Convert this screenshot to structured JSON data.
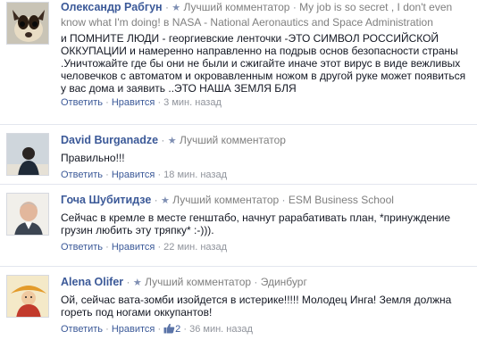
{
  "comments": [
    {
      "author": "Олександр Рабгун",
      "badge": "Лучший комментатор",
      "meta": "My job is so secret , I don't even know what I'm doing! в NASA - National Aeronautics and Space Administration",
      "text": "и ПОМНИТЕ ЛЮДИ - георгиевские ленточки -ЭТО СИМВОЛ РОССИЙСКОЙ ОККУПАЦИИ и намеренно направленно на подрыв основ безопасности страны .Уничтожайте где бы они не были и сжигайте иначе этот вирус в виде вежливых человечков с автоматом и окровавленным ножом в другой руке может появиться у вас дома и заявить ..ЭТО НАША ЗЕМЛЯ БЛЯ",
      "reply": "Ответить",
      "like": "Нравится",
      "time": "3 мин. назад"
    },
    {
      "author": "David Burganadze",
      "badge": "Лучший комментатор",
      "text": "Правильно!!!",
      "reply": "Ответить",
      "like": "Нравится",
      "time": "18 мин. назад"
    },
    {
      "author": "Гоча Шубитидзе",
      "badge": "Лучший комментатор",
      "meta": "ESM Business School",
      "text": "Сейчас в кремле в месте генштабо, начнут рарабативать план, *принуждение грузин любить эту тряпку* :-))).",
      "reply": "Ответить",
      "like": "Нравится",
      "time": "22 мин. назад"
    },
    {
      "author": "Alena Olifer",
      "badge": "Лучший комментатор",
      "meta": "Эдинбург",
      "text": "Ой, сейчас вата-зомби изойдется в истерике!!!!! Молодец Инга! Земля должна гореть под ногами оккупантов!",
      "reply": "Ответить",
      "like": "Нравится",
      "like_count": "2",
      "time": "36 мин. назад"
    }
  ],
  "colors": {
    "link": "#3b5998",
    "meta": "#7f7f7f",
    "text": "#141823",
    "divider": "#e3e6ee"
  }
}
